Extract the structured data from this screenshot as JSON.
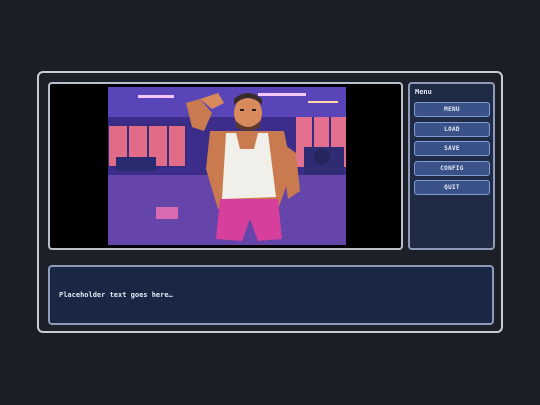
{
  "menu": {
    "title": "Menu",
    "buttons": [
      "MENU",
      "LOAD",
      "SAVE",
      "CONFIG",
      "QUIT"
    ]
  },
  "dialog": {
    "text": "Placeholder text goes here…"
  },
  "scene": {
    "icon": "gym-character-portrait",
    "colors": {
      "sky": "#6a4fc4",
      "window": "#e0708a",
      "floor": "#5a3a9a",
      "shorts": "#d83f9a",
      "tank": "#f2f2ee",
      "skin": "#d8885a"
    }
  }
}
